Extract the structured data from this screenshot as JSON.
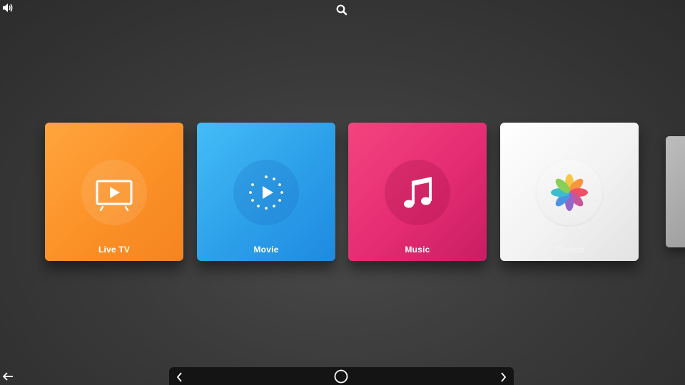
{
  "top_bar": {
    "volume_icon": "speaker-volume-icon",
    "search_icon": "search-icon"
  },
  "cards": [
    {
      "label": "Live TV",
      "icon": "tv-play-icon",
      "color": "#fb9127"
    },
    {
      "label": "Movie",
      "icon": "movie-play-icon",
      "color": "#2c9fe9"
    },
    {
      "label": "Music",
      "icon": "music-note-icon",
      "color": "#e42c72"
    },
    {
      "label": "Photos",
      "icon": "photos-pinwheel-icon",
      "color": "#f2f2f2"
    }
  ],
  "nav_bar": {
    "back_icon": "back-arrow-icon",
    "prev_icon": "chevron-left-icon",
    "home_icon": "home-circle-icon",
    "next_icon": "chevron-right-icon"
  },
  "colors": {
    "background": "#3b3b3b",
    "nav_bar": "#141414"
  }
}
